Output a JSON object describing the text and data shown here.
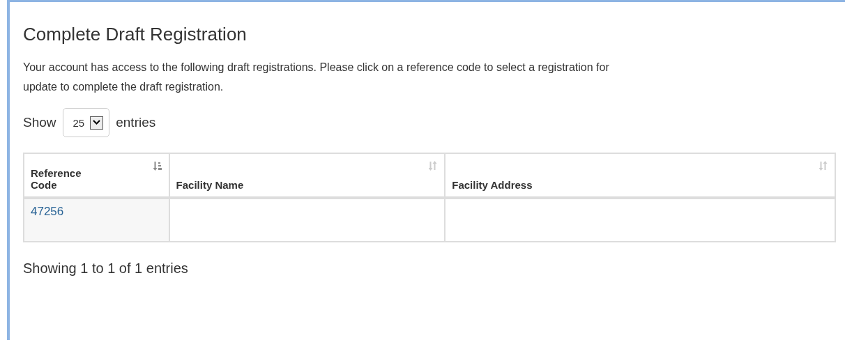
{
  "title": "Complete Draft Registration",
  "intro": "Your account has access to the following draft registrations. Please click on a reference code to select a registration for update to complete the draft registration.",
  "length_menu": {
    "before": "Show",
    "value": "25",
    "after": "entries"
  },
  "table": {
    "columns": [
      {
        "label": "Reference Code",
        "sorted": true
      },
      {
        "label": "Facility Name",
        "sorted": false
      },
      {
        "label": "Facility Address",
        "sorted": false
      }
    ],
    "rows": [
      {
        "reference_code": "47256"
      }
    ]
  },
  "info": "Showing 1 to 1 of 1 entries"
}
